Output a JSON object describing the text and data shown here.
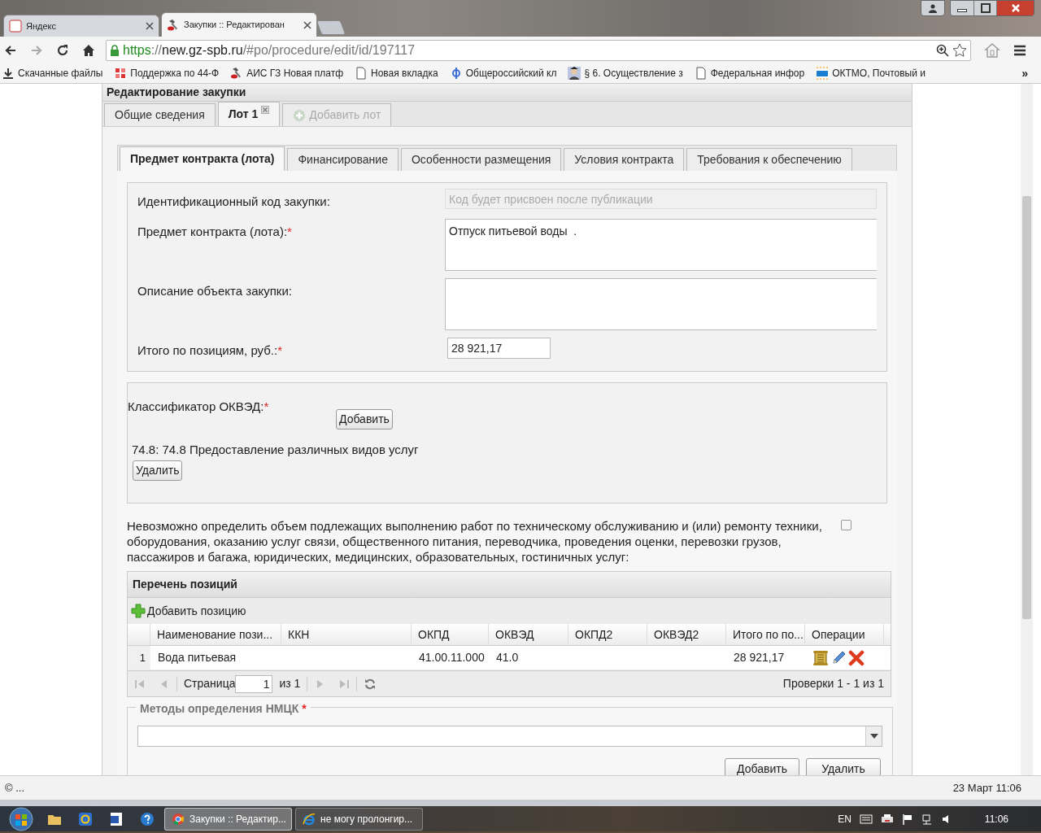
{
  "browser": {
    "tabs": [
      {
        "label": "Яндекс",
        "selected": false
      },
      {
        "label": "Закупки :: Редактирован",
        "selected": true
      }
    ],
    "url": [
      {
        "kind": "scheme",
        "text": "https"
      },
      {
        "kind": "dim",
        "text": "://"
      },
      {
        "kind": "host",
        "text": "new.gz-spb.ru"
      },
      {
        "kind": "dim",
        "text": "/#po/procedure/edit/id/197117"
      }
    ],
    "bookmarks": [
      {
        "label": "Скачанные файлы"
      },
      {
        "label": "Поддержка по 44-Ф"
      },
      {
        "label": "АИС ГЗ Новая платф"
      },
      {
        "label": "Новая вкладка"
      },
      {
        "label": "Общероссийский кл"
      },
      {
        "label": "§ 6. Осуществление з"
      },
      {
        "label": "Федеральная инфор"
      },
      {
        "label": "ОКТМО, Почтовый и"
      }
    ],
    "bookmarks_more": "»"
  },
  "page": {
    "title": "Редактирование закупки",
    "top_tabs": [
      {
        "label": "Общие сведения",
        "selected": false,
        "kind": "plain"
      },
      {
        "label": "Лот 1",
        "selected": true,
        "kind": "closable"
      },
      {
        "label": "Добавить лот",
        "selected": false,
        "kind": "add"
      }
    ],
    "sub_tabs": [
      {
        "label": "Предмет контракта (лота)",
        "selected": true
      },
      {
        "label": "Финансирование",
        "selected": false
      },
      {
        "label": "Особенности размещения",
        "selected": false
      },
      {
        "label": "Условия контракта",
        "selected": false
      },
      {
        "label": "Требования к обеспечению",
        "selected": false
      }
    ],
    "fields": [
      {
        "label": "Идентификационный код закупки:",
        "kind": "readonly",
        "placeholder": "Код будет присвоен после публикации"
      },
      {
        "label": "Предмет контракта (лота):",
        "required_mark": "*",
        "kind": "textarea",
        "value": "Отпуск питьевой воды  ."
      },
      {
        "label": "Описание объекта закупки:",
        "kind": "textarea"
      },
      {
        "label": "Итого по позициям, руб.:",
        "required_mark": "*",
        "kind": "short",
        "value": "28 921,17"
      }
    ],
    "okved": {
      "label": "Классификатор ОКВЭД:",
      "required_mark": "*",
      "add_button": "Добавить",
      "item": "74.8: 74.8 Предоставление различных видов услуг",
      "delete_button": "Удалить"
    },
    "volume_checkbox": {
      "label": "Невозможно определить объем подлежащих выполнению работ по техническому обслуживанию и (или) ремонту техники, оборудования, оказанию услуг связи, общественного питания, переводчика, проведения оценки, перевозки грузов, пассажиров и багажа, юридических, медицинских, образовательных, гостиничных услуг:",
      "checked": false
    },
    "positions": {
      "title": "Перечень позиций",
      "add_label": "Добавить позицию",
      "columns": [
        "Наименование пози...",
        "ККН",
        "ОКПД",
        "ОКВЭД",
        "ОКПД2",
        "ОКВЭД2",
        "Итого по по...",
        "Операции"
      ],
      "rows": [
        {
          "number": "1",
          "cells": [
            "Вода питьевая",
            "",
            "41.00.11.000",
            "41.0",
            "",
            "",
            "28 921,17"
          ]
        }
      ],
      "pager": {
        "page_label": "Страница",
        "page": "1",
        "of": "из 1",
        "summary": "Проверки 1 - 1 из 1"
      }
    },
    "methods": {
      "legend": "Методы определения НМЦК",
      "required_mark": "*",
      "add_button": "Добавить",
      "delete_button": "Удалить"
    }
  },
  "status_bar": {
    "left": "© ...",
    "right": "23 Март 11:06"
  },
  "taskbar": {
    "tasks": [
      {
        "label": "Закупки :: Редактир...",
        "selected": true
      },
      {
        "label": "не могу пролонгир...",
        "selected": false
      }
    ],
    "lang": "EN",
    "clock": "11:06"
  }
}
